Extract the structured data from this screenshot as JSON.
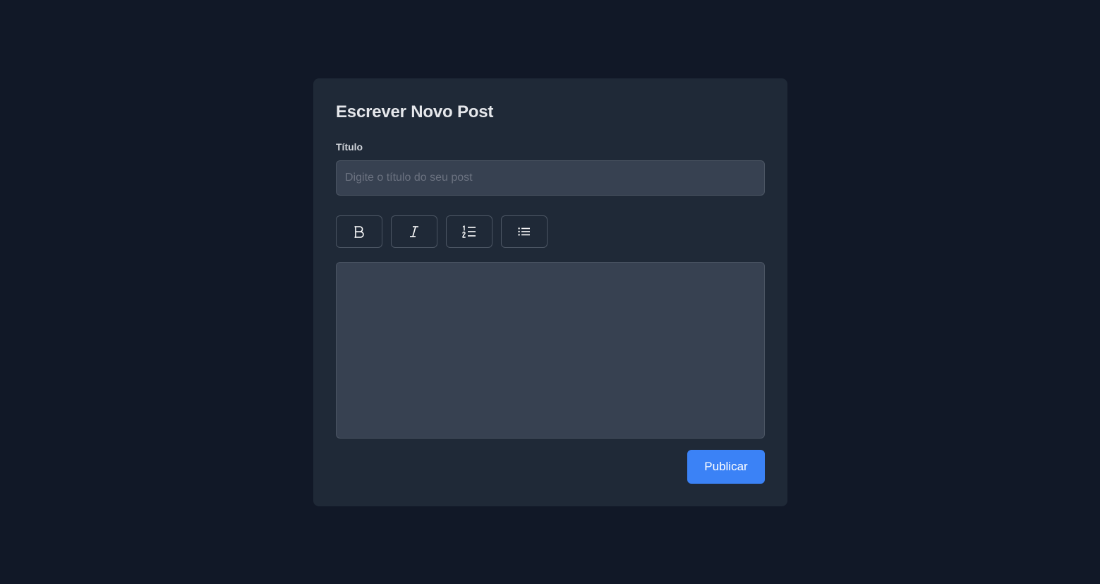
{
  "form": {
    "heading": "Escrever Novo Post",
    "title_label": "Título",
    "title_placeholder": "Digite o título do seu post",
    "title_value": "",
    "body_value": "",
    "publish_label": "Publicar"
  },
  "toolbar": {
    "buttons": [
      {
        "name": "bold",
        "icon": "bold-icon"
      },
      {
        "name": "italic",
        "icon": "italic-icon"
      },
      {
        "name": "ordered-list",
        "icon": "ordered-list-icon"
      },
      {
        "name": "bullet-list",
        "icon": "bullet-list-icon"
      }
    ]
  },
  "colors": {
    "background": "#111827",
    "card": "#1f2937",
    "input": "#374151",
    "border": "#4b5563",
    "accent": "#3b82f6"
  }
}
